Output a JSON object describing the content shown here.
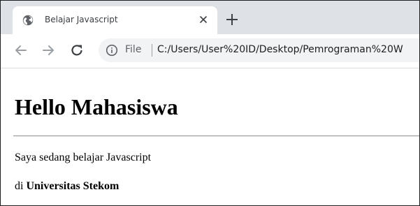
{
  "browser": {
    "tab": {
      "title": "Belajar Javascript",
      "favicon": "globe-icon",
      "close": "close-icon"
    },
    "new_tab": "plus-icon",
    "toolbar": {
      "back": "back-arrow-icon",
      "forward": "forward-arrow-icon",
      "reload": "reload-icon",
      "info": "info-icon",
      "scheme_label": "File",
      "url": "C:/Users/User%20ID/Desktop/Pemrograman%20W"
    },
    "colors": {
      "tabstrip": "#dee1e6",
      "omnibox": "#f1f3f4",
      "frame": "#1f1f1f"
    }
  },
  "page": {
    "heading": "Hello Mahasiswa",
    "paragraph1": "Saya sedang belajar Javascript",
    "paragraph2_prefix": "di ",
    "paragraph2_bold": "Universitas Stekom"
  }
}
